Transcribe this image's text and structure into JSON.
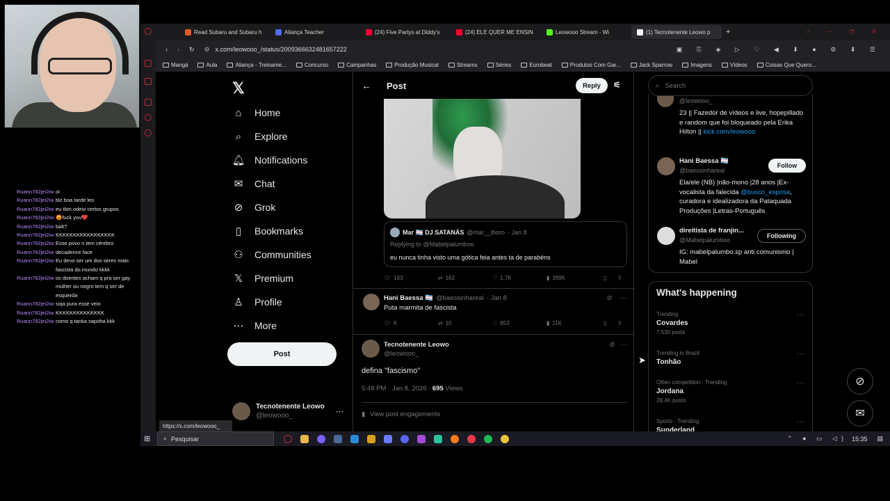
{
  "chat": [
    {
      "user": "Ruann782jei2iw",
      "msg": "oi"
    },
    {
      "user": "Ruann782jei2iw",
      "msg": "blz boa tarde leo"
    },
    {
      "user": "Ruann782jei2iw",
      "msg": "eu tbm odeio certos grupos"
    },
    {
      "user": "Ruann782jei2iw",
      "msg": "😡fuck you❤️"
    },
    {
      "user": "Ruann782jei2iw",
      "msg": "balt?"
    },
    {
      "user": "Ruann782jei2iw",
      "msg": "KKKKKKKKKKKKKKKKK"
    },
    {
      "user": "Ruann782jei2iw",
      "msg": "Esse povo n tem cérebro"
    },
    {
      "user": "Ruann782jei2iw",
      "msg": "decadence face"
    },
    {
      "user": "Ruann782jei2iw",
      "msg": "Eu devo ser um dos seres mais fascista do mundo kkkk"
    },
    {
      "user": "Ruann782jei2iw",
      "msg": "os doentes acham q pra ser gay mulher ou negro tem q ser de esquerda"
    },
    {
      "user": "Ruann782jei2iw",
      "msg": "soja pura esse veio"
    },
    {
      "user": "Ruann782jei2iw",
      "msg": "KKKKKKKKKKKKKK"
    },
    {
      "user": "Ruann782jei2iw",
      "msg": "como q tanka sapoha kkk"
    }
  ],
  "tabs": [
    {
      "label": "Read Subaru and Subaru h",
      "color": "#e05a2b"
    },
    {
      "label": "Aliança Teacher",
      "color": "#4d6fe8"
    },
    {
      "label": "(24) Five Partys at Diddy's",
      "color": "#ff0033"
    },
    {
      "label": "(24) ELE QUER ME ENSIN",
      "color": "#ff0033"
    },
    {
      "label": "Leowooo Stream - Wi",
      "color": "#53fc18"
    },
    {
      "label": "(1) Tecnotenente Leowo p",
      "color": "#ffffff",
      "active": true
    }
  ],
  "url": "x.com/leowooo_/status/2009366632481657222",
  "bookmarks": [
    "Mangá",
    "Aula",
    "Aliança - Treiname...",
    "Concurso",
    "Campanhas",
    "Produção Musical",
    "Streams",
    "Séries",
    "Eurobeat",
    "Produtos Com Gar...",
    "Jack Sparrow",
    "Imagens",
    "Vídeos",
    "Coisas Que Quero..."
  ],
  "nav": [
    {
      "label": "Home",
      "icon": "⌂",
      "name": "home"
    },
    {
      "label": "Explore",
      "icon": "⌕",
      "name": "explore"
    },
    {
      "label": "Notifications",
      "icon": "🔔︎",
      "name": "notifications"
    },
    {
      "label": "Chat",
      "icon": "✉",
      "name": "chat"
    },
    {
      "label": "Grok",
      "icon": "⊘",
      "name": "grok"
    },
    {
      "label": "Bookmarks",
      "icon": "▯",
      "name": "bookmarks"
    },
    {
      "label": "Communities",
      "icon": "⚇",
      "name": "communities"
    },
    {
      "label": "Premium",
      "icon": "𝕏",
      "name": "premium"
    },
    {
      "label": "Profile",
      "icon": "♙",
      "name": "profile"
    },
    {
      "label": "More",
      "icon": "⋯",
      "name": "more"
    }
  ],
  "post_button": "Post",
  "account": {
    "name": "Tecnotenente Leowo",
    "handle": "@leowooo_"
  },
  "header": {
    "title": "Post",
    "reply": "Reply"
  },
  "quote": {
    "name": "Mar 🏳️‍⚧️ DJ SATANÁS",
    "handle": "@mar__lboro",
    "date": "· Jan 8",
    "replying": "Replying to @Mabelpalumboo",
    "text": "eu nunca tinha visto uma gótica feia antes ta de parabéns"
  },
  "main_actions": {
    "replies": "163",
    "reposts": "162",
    "likes": "1.7K",
    "views": "399K"
  },
  "reply1": {
    "name": "Hani Baessa 🏳️‍⚧️",
    "handle": "@baessinhareal",
    "date": "· Jan 8",
    "text": "Puta marmita de fascista",
    "replies": "6",
    "reposts": "10",
    "likes": "853",
    "views": "11K"
  },
  "reply2": {
    "name": "Tecnotenente Leowo",
    "handle": "@leowooo_",
    "text": "defina \"fascismo\"",
    "time": "5:48 PM · Jan 8, 2026 · ",
    "views_num": "695",
    "views_label": " Views",
    "engagements": "View post engagements"
  },
  "search_placeholder": "Search",
  "who_follow": {
    "top": {
      "handle": "@leowooo_",
      "bio": "23 || Fazedor de vídeos e live, hopepillado e random que foi bloqueado pela Erika Hilton ||",
      "link": "kick.com/leowooo"
    },
    "user1": {
      "name": "Hani Baessa 🏳️‍⚧️",
      "handle": "@baessinhareal",
      "button": "Follow",
      "bio1": "Ela/ele (NB) |não-mono |28 anos |Ex-vocalista da falecida ",
      "mention": "@busco_esposa",
      "bio2": ", curadora e idealizadora da Pataquada Produções |Letras-Português"
    },
    "user2": {
      "name": "direitista de franjin...",
      "handle": "@Mabelpalumboo",
      "button": "Following",
      "bio": "IG: mabelpalumbo.sp anti comunismo | Mabel"
    }
  },
  "happening": {
    "title": "What's happening",
    "trends": [
      {
        "cat": "Trending",
        "name": "Covardes",
        "count": "7,530 posts"
      },
      {
        "cat": "Trending in Brazil",
        "name": "Tonhão",
        "count": ""
      },
      {
        "cat": "Other competition · Trending",
        "name": "Jordana",
        "count": "28.4K posts"
      },
      {
        "cat": "Sports · Trending",
        "name": "Sunderland",
        "count": ""
      }
    ]
  },
  "status_url": "https://x.com/leowooo_",
  "taskbar": {
    "search": "Pesquisar",
    "time": "15:35"
  }
}
